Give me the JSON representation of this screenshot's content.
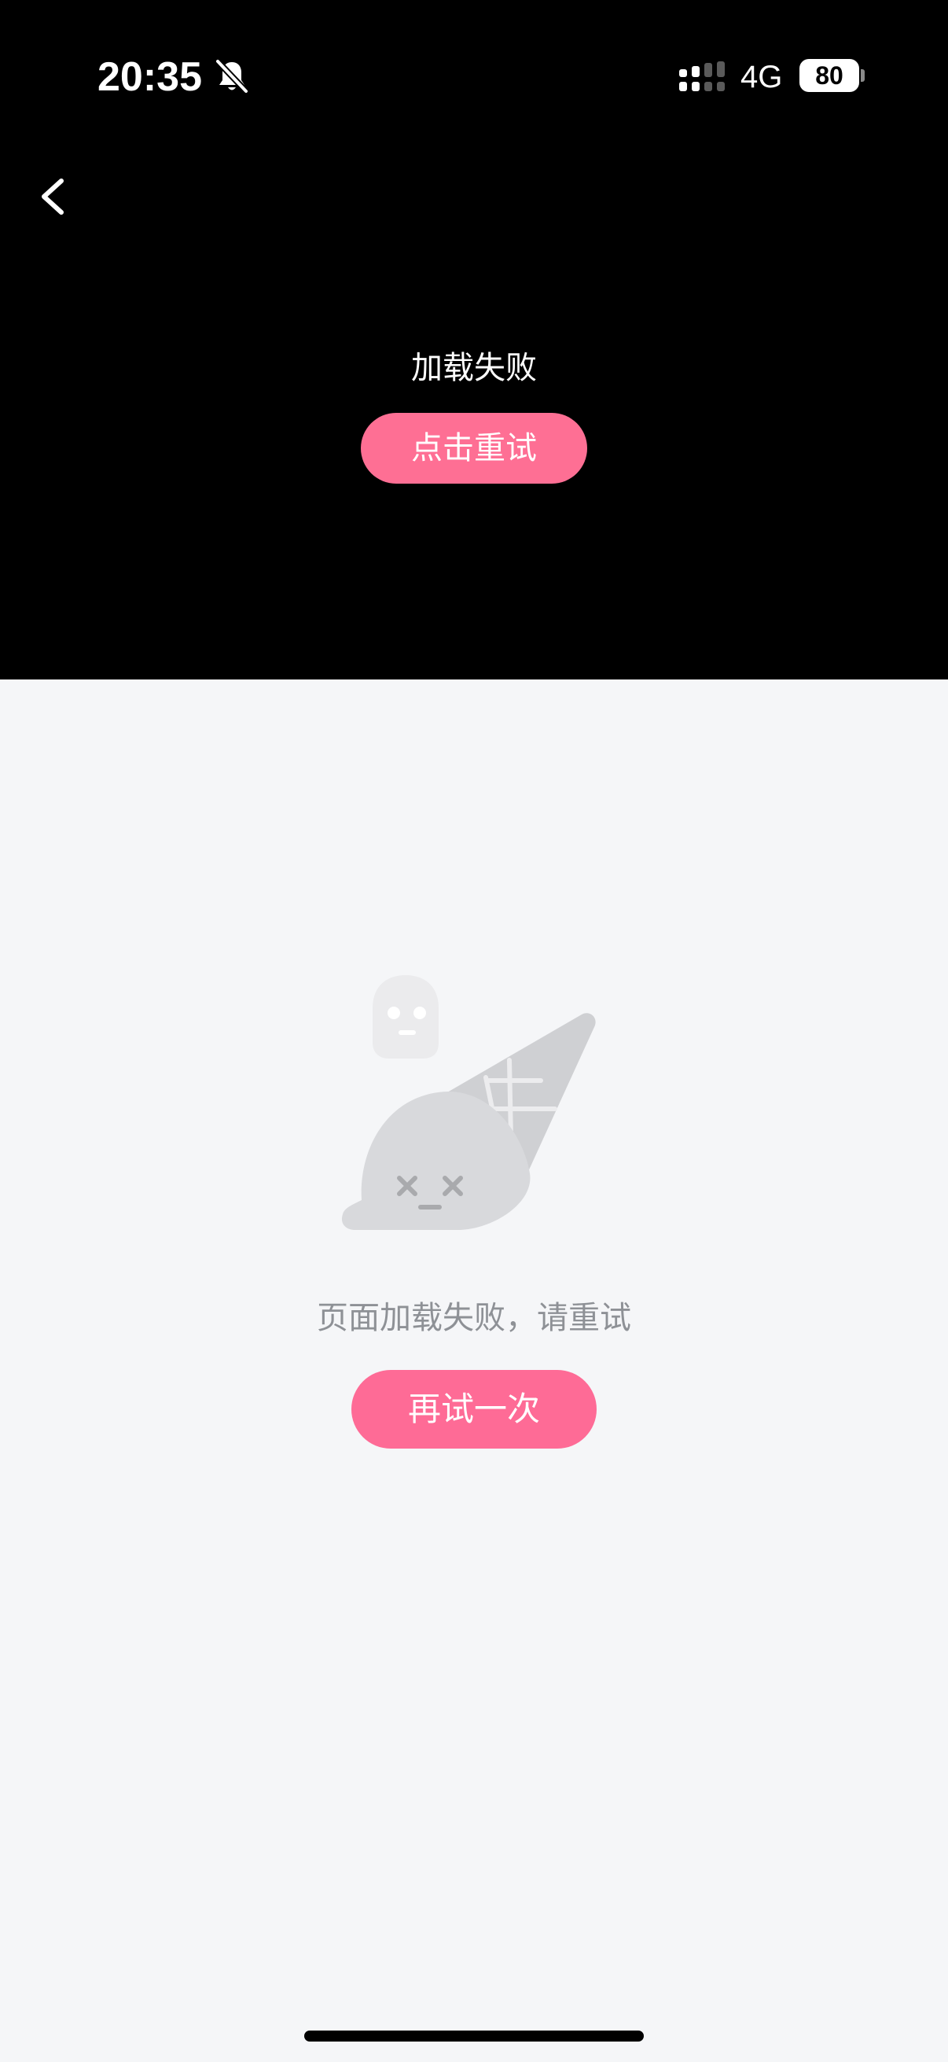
{
  "status_bar": {
    "time": "20:35",
    "network": "4G",
    "battery": "80"
  },
  "player": {
    "error_text": "加载失败",
    "retry_label": "点击重试"
  },
  "content": {
    "error_text": "页面加载失败，请重试",
    "retry_label": "再试一次"
  },
  "colors": {
    "accent": "#fe6b96",
    "player_bg": "#000000",
    "page_bg": "#f5f6f8",
    "muted_text": "#8e9196"
  }
}
